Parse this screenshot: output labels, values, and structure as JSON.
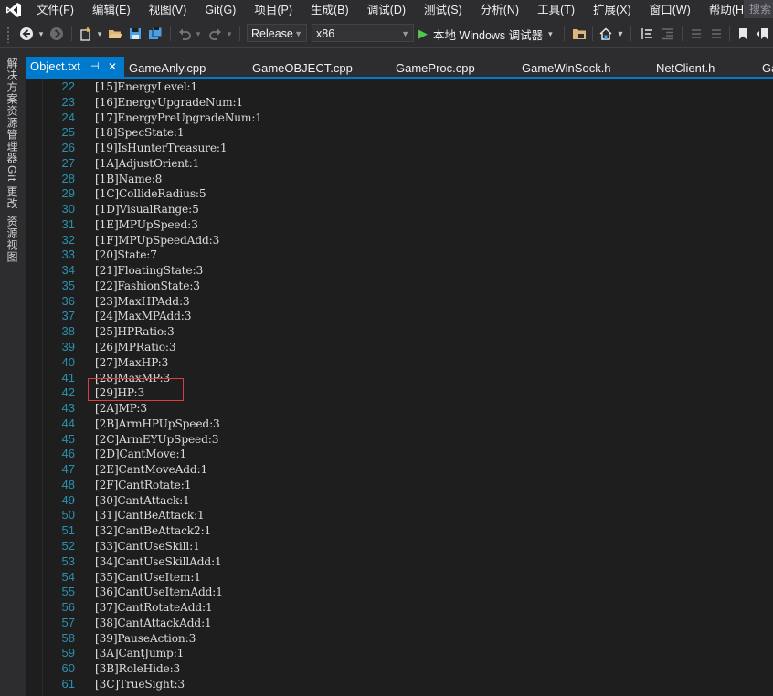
{
  "menu": {
    "items": [
      "文件(F)",
      "编辑(E)",
      "视图(V)",
      "Git(G)",
      "项目(P)",
      "生成(B)",
      "调试(D)",
      "测试(S)",
      "分析(N)",
      "工具(T)",
      "扩展(X)",
      "窗口(W)",
      "帮助(H)"
    ],
    "search_placeholder": "搜索"
  },
  "toolbar": {
    "configuration": "Release",
    "platform": "x86",
    "run_label": "本地 Windows 调试器"
  },
  "side_tabs": [
    "解决方案资源管理器",
    "Git 更改",
    "资源视图"
  ],
  "tabs": {
    "active": "Object.txt",
    "active_pin_icon": "pin-icon",
    "active_close": "✕",
    "others": [
      "GameAnly.cpp",
      "GameOBJECT.cpp",
      "GameProc.cpp",
      "GameWinSock.h",
      "NetClient.h",
      "Ga"
    ]
  },
  "editor": {
    "lines": [
      {
        "n": "22",
        "text": "[15]EnergyLevel:1"
      },
      {
        "n": "23",
        "text": "[16]EnergyUpgradeNum:1"
      },
      {
        "n": "24",
        "text": "[17]EnergyPreUpgradeNum:1"
      },
      {
        "n": "25",
        "text": "[18]SpecState:1"
      },
      {
        "n": "26",
        "text": "[19]IsHunterTreasure:1"
      },
      {
        "n": "27",
        "text": "[1A]AdjustOrient:1"
      },
      {
        "n": "28",
        "text": "[1B]Name:8"
      },
      {
        "n": "29",
        "text": "[1C]CollideRadius:5"
      },
      {
        "n": "30",
        "text": "[1D]VisualRange:5"
      },
      {
        "n": "31",
        "text": "[1E]MPUpSpeed:3"
      },
      {
        "n": "32",
        "text": "[1F]MPUpSpeedAdd:3"
      },
      {
        "n": "33",
        "text": "[20]State:7"
      },
      {
        "n": "34",
        "text": "[21]FloatingState:3"
      },
      {
        "n": "35",
        "text": "[22]FashionState:3"
      },
      {
        "n": "36",
        "text": "[23]MaxHPAdd:3"
      },
      {
        "n": "37",
        "text": "[24]MaxMPAdd:3"
      },
      {
        "n": "38",
        "text": "[25]HPRatio:3"
      },
      {
        "n": "39",
        "text": "[26]MPRatio:3"
      },
      {
        "n": "40",
        "text": "[27]MaxHP:3"
      },
      {
        "n": "41",
        "text": "[28]MaxMP:3"
      },
      {
        "n": "42",
        "text": "[29]HP:3"
      },
      {
        "n": "43",
        "text": "[2A]MP:3"
      },
      {
        "n": "44",
        "text": "[2B]ArmHPUpSpeed:3"
      },
      {
        "n": "45",
        "text": "[2C]ArmEYUpSpeed:3"
      },
      {
        "n": "46",
        "text": "[2D]CantMove:1"
      },
      {
        "n": "47",
        "text": "[2E]CantMoveAdd:1"
      },
      {
        "n": "48",
        "text": "[2F]CantRotate:1"
      },
      {
        "n": "49",
        "text": "[30]CantAttack:1"
      },
      {
        "n": "50",
        "text": "[31]CantBeAttack:1"
      },
      {
        "n": "51",
        "text": "[32]CantBeAttack2:1"
      },
      {
        "n": "52",
        "text": "[33]CantUseSkill:1"
      },
      {
        "n": "53",
        "text": "[34]CantUseSkillAdd:1"
      },
      {
        "n": "54",
        "text": "[35]CantUseItem:1"
      },
      {
        "n": "55",
        "text": "[36]CantUseItemAdd:1"
      },
      {
        "n": "56",
        "text": "[37]CantRotateAdd:1"
      },
      {
        "n": "57",
        "text": "[38]CantAttackAdd:1"
      },
      {
        "n": "58",
        "text": "[39]PauseAction:3"
      },
      {
        "n": "59",
        "text": "[3A]CantJump:1"
      },
      {
        "n": "60",
        "text": "[3B]RoleHide:3"
      },
      {
        "n": "61",
        "text": "[3C]TrueSight:3"
      }
    ],
    "highlighted_line": "42",
    "highlight_color": "#e03c3c",
    "line_number_color": "#2b91af",
    "text_color": "#dcdcdc"
  }
}
